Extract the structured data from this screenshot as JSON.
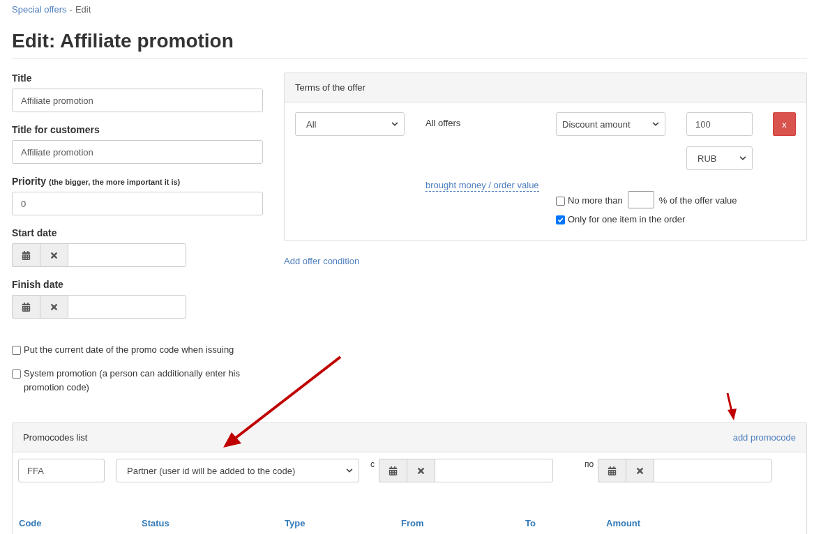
{
  "breadcrumb": {
    "link": "Special offers",
    "separator": "-",
    "current": "Edit"
  },
  "heading": "Edit: Affiliate promotion",
  "fields": [
    {
      "kind": "text",
      "label": "Title",
      "value": "Affiliate promotion"
    },
    {
      "kind": "text",
      "label": "Title for customers",
      "value": "Affiliate promotion"
    },
    {
      "kind": "text",
      "label": "Priority",
      "hint": "(the bigger, the more important it is)",
      "value": "0"
    },
    {
      "kind": "date",
      "label": "Start date"
    },
    {
      "kind": "date",
      "label": "Finish date"
    }
  ],
  "options": [
    {
      "label": "Put the current date of the promo code when issuing",
      "checked": false
    },
    {
      "label": "System promotion (a person can additionally enter his promotion code)",
      "checked": false
    }
  ],
  "terms": {
    "title": "Terms of the offer",
    "scope_select": "All",
    "scope_text": "All offers",
    "discount_select": "Discount amount",
    "amount": "100",
    "currency_select": "RUB",
    "remove_button": "x",
    "basis_link": "brought money / order value",
    "limit": {
      "checked": false,
      "label_before": "No more than",
      "label_after": "% of the offer value"
    },
    "single_item": {
      "checked": true,
      "label": "Only for one item in the order"
    }
  },
  "add_condition": "Add offer condition",
  "promocodes": {
    "title": "Promocodes list",
    "add_link": "add promocode",
    "code": "FFA",
    "type_select": "Partner (user id will be added to the code)",
    "from_label": "с",
    "to_label": "по",
    "columns": [
      "Code",
      "Status",
      "Type",
      "From",
      "To",
      "Amount"
    ]
  }
}
